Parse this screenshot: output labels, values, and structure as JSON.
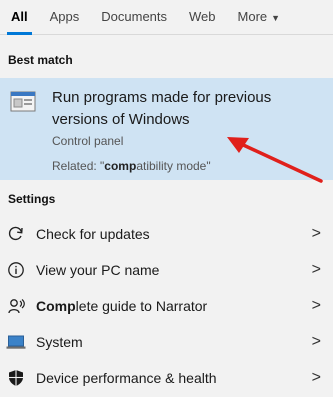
{
  "tabs": [
    {
      "label": "All"
    },
    {
      "label": "Apps"
    },
    {
      "label": "Documents"
    },
    {
      "label": "Web"
    },
    {
      "label": "More"
    }
  ],
  "best_match": {
    "section_label": "Best match",
    "title": "Run programs made for previous versions of Windows",
    "subtitle": "Control panel",
    "related_prefix": "Related: \"",
    "related_bold": "comp",
    "related_rest": "atibility mode\""
  },
  "settings": {
    "section_label": "Settings",
    "items": [
      {
        "label": "Check for updates",
        "icon": "refresh-icon"
      },
      {
        "label": "View your PC name",
        "icon": "info-icon"
      },
      {
        "label_bold": "Comp",
        "label_rest": "lete guide to Narrator",
        "icon": "narrator-icon"
      },
      {
        "label": "System",
        "icon": "laptop-icon"
      },
      {
        "label": "Device performance & health",
        "icon": "shield-icon"
      }
    ]
  },
  "colors": {
    "accent": "#0078d7",
    "highlight": "#cfe3f3",
    "annotation_arrow": "#e0201b"
  }
}
